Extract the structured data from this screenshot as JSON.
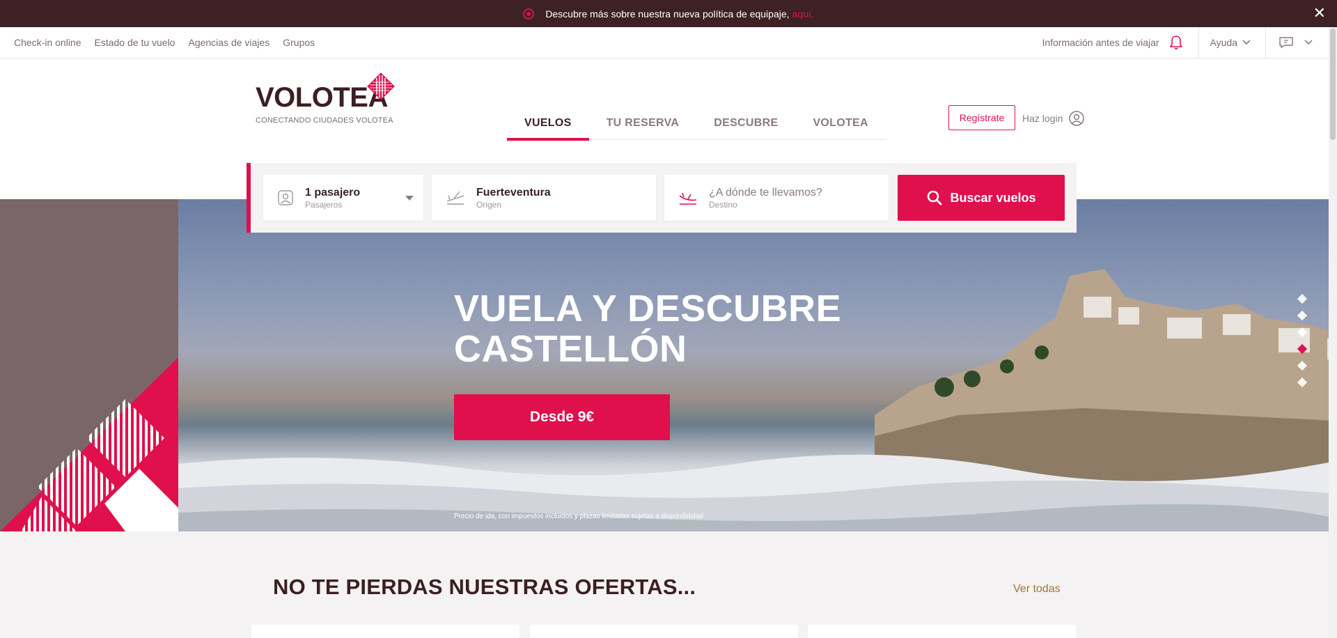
{
  "announcement": {
    "text": "Descubre más sobre nuestra nueva política de equipaje,",
    "link": "aquí.",
    "icon": "radio-dot-icon",
    "close_icon": "close-icon"
  },
  "utility_nav": {
    "left_links": [
      "Check-in online",
      "Estado de tu vuelo",
      "Agencias de viajes",
      "Grupos"
    ],
    "info": "Información antes de viajar",
    "help": "Ayuda",
    "colors": {
      "bell": "#e0104d"
    }
  },
  "header": {
    "logo_word": "VOLOTEA",
    "logo_tagline": "CONECTANDO CIUDADES VOLOTEA",
    "tabs": [
      {
        "label": "VUELOS",
        "active": true
      },
      {
        "label": "TU RESERVA",
        "active": false
      },
      {
        "label": "DESCUBRE",
        "active": false
      },
      {
        "label": "VOLOTEA",
        "active": false
      }
    ],
    "register": "Regístrate",
    "login": "Haz login"
  },
  "search": {
    "passengers": {
      "value": "1 pasajero",
      "label": "Pasajeros"
    },
    "origin": {
      "value": "Fuerteventura",
      "label": "Origen"
    },
    "destination": {
      "placeholder": "¿A dónde te llevamos?",
      "label": "Destino"
    },
    "button": "Buscar vuelos"
  },
  "hero": {
    "headline_line1": "VUELA Y DESCUBRE",
    "headline_line2": "CASTELLÓN",
    "cta": "Desde 9€",
    "disclaimer": "Precio de ida, con impuestos incluidos y plazas limitadas sujetas a disponibilidad.",
    "slides_total": 6,
    "slide_active": 4
  },
  "offers": {
    "title": "NO TE PIERDAS NUESTRAS OFERTAS...",
    "see_all": "Ver todas"
  },
  "colors": {
    "brand": "#e0104d",
    "dark": "#3b1f23",
    "topbar": "#3d2124",
    "see_all": "#9b7a2e"
  }
}
